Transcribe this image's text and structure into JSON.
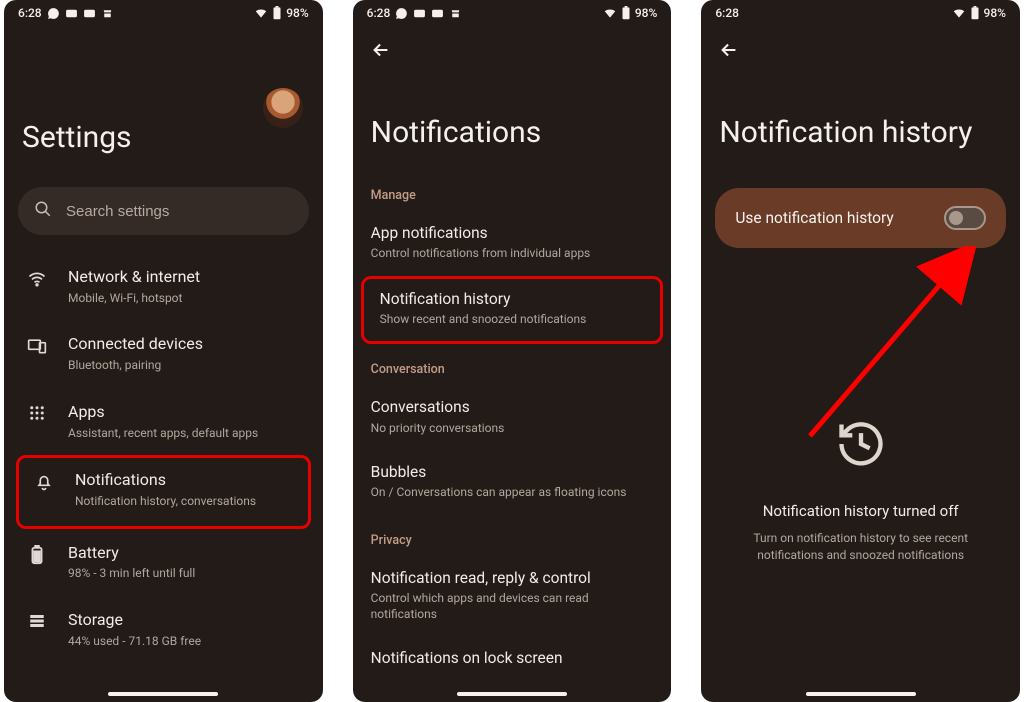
{
  "status": {
    "time": "6:28",
    "battery": "98%"
  },
  "phone1": {
    "title": "Settings",
    "search_placeholder": "Search settings",
    "items": [
      {
        "title": "Network & internet",
        "subtitle": "Mobile, Wi-Fi, hotspot",
        "icon": "wifi-icon"
      },
      {
        "title": "Connected devices",
        "subtitle": "Bluetooth, pairing",
        "icon": "devices-icon"
      },
      {
        "title": "Apps",
        "subtitle": "Assistant, recent apps, default apps",
        "icon": "apps-grid-icon"
      },
      {
        "title": "Notifications",
        "subtitle": "Notification history, conversations",
        "icon": "bell-icon",
        "highlight": true
      },
      {
        "title": "Battery",
        "subtitle": "98% - 3 min left until full",
        "icon": "battery-icon"
      },
      {
        "title": "Storage",
        "subtitle": "44% used - 71.18 GB free",
        "icon": "storage-icon"
      }
    ]
  },
  "phone2": {
    "title": "Notifications",
    "sections": [
      {
        "label": "Manage",
        "items": [
          {
            "title": "App notifications",
            "subtitle": "Control notifications from individual apps"
          },
          {
            "title": "Notification history",
            "subtitle": "Show recent and snoozed notifications",
            "highlight": true
          }
        ]
      },
      {
        "label": "Conversation",
        "items": [
          {
            "title": "Conversations",
            "subtitle": "No priority conversations"
          },
          {
            "title": "Bubbles",
            "subtitle": "On / Conversations can appear as floating icons"
          }
        ]
      },
      {
        "label": "Privacy",
        "items": [
          {
            "title": "Notification read, reply & control",
            "subtitle": "Control which apps and devices can read notifications"
          },
          {
            "title": "Notifications on lock screen",
            "subtitle": ""
          }
        ]
      }
    ]
  },
  "phone3": {
    "title": "Notification history",
    "toggle_label": "Use notification history",
    "toggle_on": false,
    "empty_title": "Notification history turned off",
    "empty_sub": "Turn on notification history to see recent notifications and snoozed notifications"
  }
}
